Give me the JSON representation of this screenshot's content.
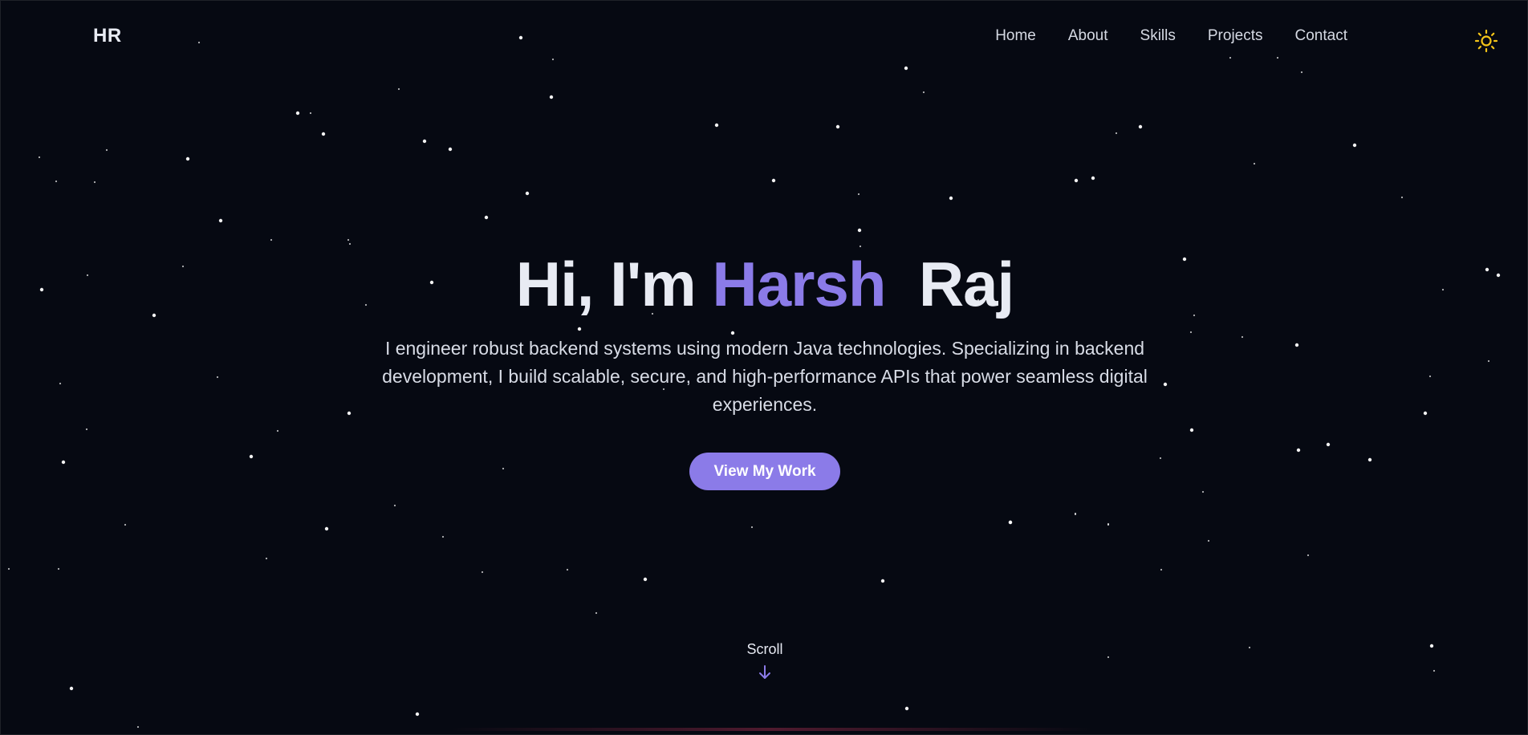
{
  "nav": {
    "logo": "HR",
    "links": [
      "Home",
      "About",
      "Skills",
      "Projects",
      "Contact"
    ],
    "theme_toggle_icon": "sun-icon"
  },
  "hero": {
    "greeting": "Hi, I'm",
    "first_name": "Harsh",
    "last_name": "Raj",
    "description": "I engineer robust backend systems using modern Java technologies. Specializing in backend development, I build scalable, secure, and high-performance APIs that power seamless digital experiences.",
    "cta_label": "View My Work"
  },
  "scroll": {
    "label": "Scroll",
    "icon": "arrow-down-icon"
  },
  "colors": {
    "background": "#060912",
    "accent": "#8b7be8",
    "sun": "#f5c518",
    "text": "#e8ebf3"
  }
}
